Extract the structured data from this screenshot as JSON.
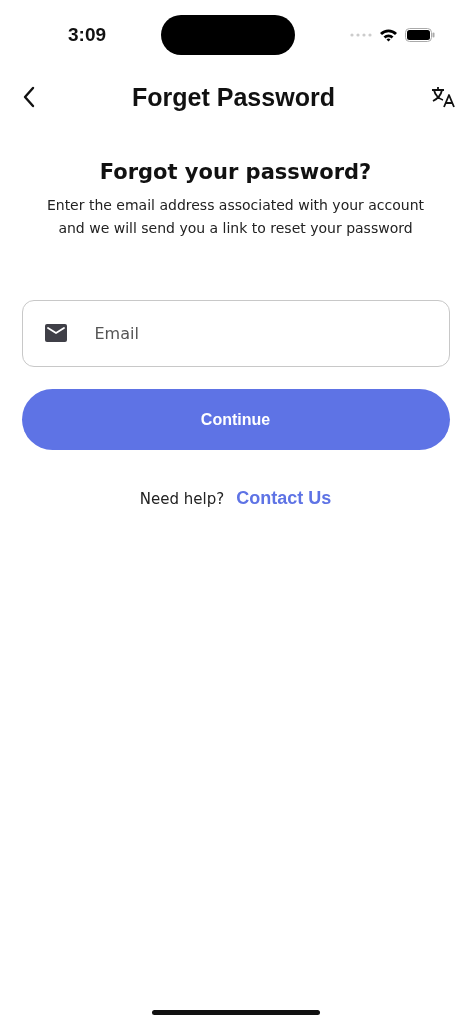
{
  "status_bar": {
    "time": "3:09"
  },
  "header": {
    "title": "Forget Password"
  },
  "heading": "Forgot your password?",
  "description": "Enter the email address associated with your account and we will send you a link to reset your password",
  "email_field": {
    "placeholder": "Email"
  },
  "continue_button": "Continue",
  "help": {
    "text": "Need help?",
    "link": "Contact Us"
  }
}
